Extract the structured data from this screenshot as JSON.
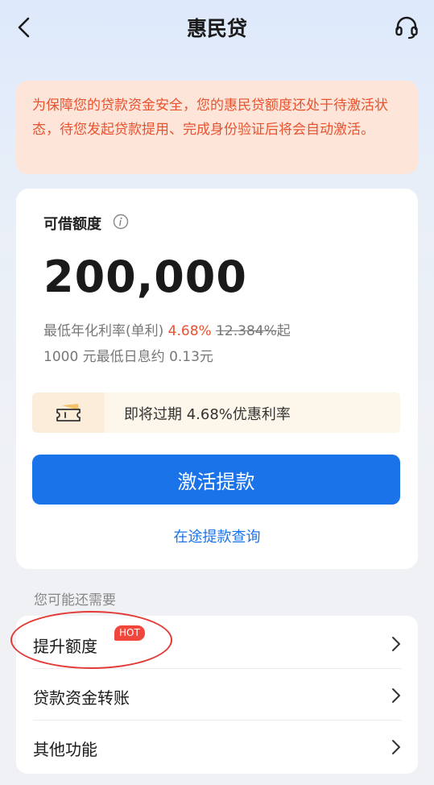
{
  "header": {
    "title": "惠民贷",
    "back_icon": "chevron-left-icon",
    "service_icon": "headset-icon"
  },
  "notice": {
    "text": "为保障您的贷款资金安全，您的惠民贷额度还处于待激活状态，待您发起贷款提用、完成身份验证后将会自动激活。"
  },
  "loan": {
    "label": "可借额度",
    "info_icon": "info-icon",
    "amount": "200,000",
    "rate_prefix": "最低年化利率(单利)",
    "rate": "4.68%",
    "rate_old": "12.384%",
    "rate_suffix": "起",
    "interest_note": "1000 元最低日息约 0.13元",
    "promo_icon": "ticket-icon",
    "promo_text": "即将过期 4.68%优惠利率",
    "cta_label": "激活提款",
    "link_label": "在途提款查询"
  },
  "more": {
    "section_label": "您可能还需要",
    "items": [
      {
        "label": "提升额度",
        "badge": "HOT"
      },
      {
        "label": "贷款资金转账"
      },
      {
        "label": "其他功能"
      }
    ]
  },
  "colors": {
    "accent_blue": "#1a73e8",
    "notice_text": "#e9522f",
    "notice_bg": "#fde5d9",
    "badge_red": "#f0463c",
    "annotation_red": "#e33a36"
  }
}
